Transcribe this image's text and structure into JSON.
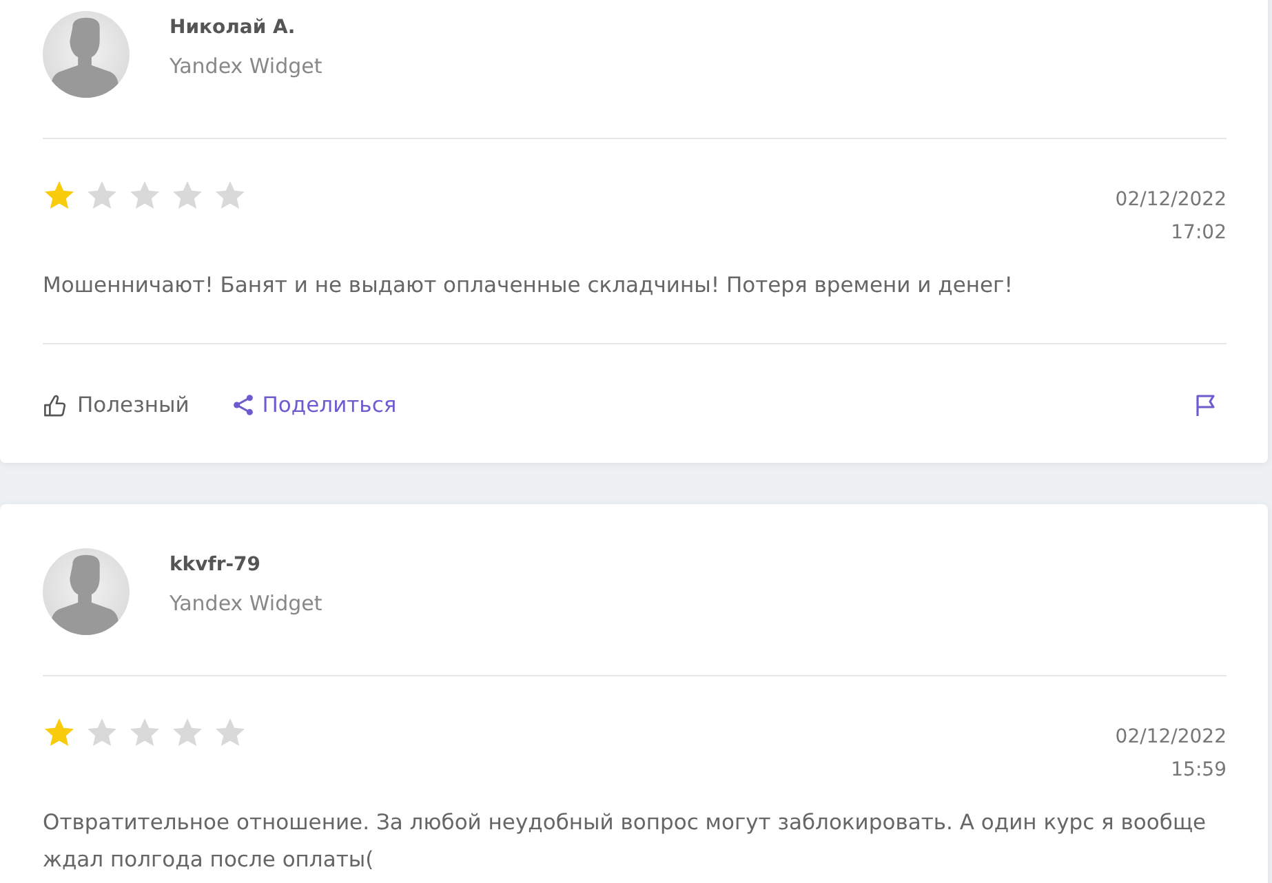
{
  "reviews": [
    {
      "author": "Николай А.",
      "source": "Yandex Widget",
      "stars": 1,
      "date": "02/12/2022",
      "time": "17:02",
      "text": "Мошенничают! Банят и не выдают оплаченные складчины! Потеря времени и денег!",
      "actions": [
        {
          "kind": "helpful",
          "label": "Полезный"
        },
        {
          "kind": "share",
          "label": "Поделиться"
        },
        {
          "kind": "report"
        }
      ]
    },
    {
      "author": "kkvfr-79",
      "source": "Yandex Widget",
      "stars": 1,
      "date": "02/12/2022",
      "time": "15:59",
      "text": "Отвратительное отношение. За любой неудобный вопрос могут заблокировать. А один курс я вообще ждал полгода после оплаты("
    }
  ]
}
